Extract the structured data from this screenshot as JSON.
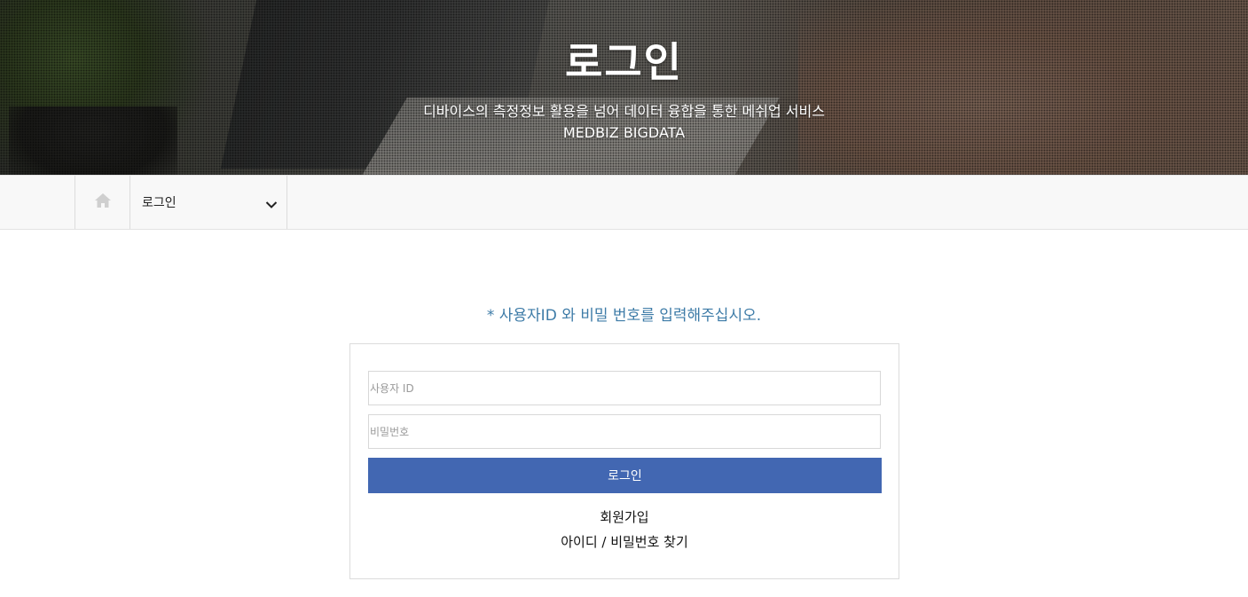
{
  "hero": {
    "title": "로그인",
    "subtitle": "디바이스의 측정정보 활용을 넘어 데이터 융합을 통한 메쉬업 서비스",
    "subtitle2": "MEDBIZ BIGDATA"
  },
  "breadcrumb": {
    "home_icon": "home-icon",
    "current": "로그인",
    "dropdown_icon": "chevron-down-icon"
  },
  "login": {
    "notice": "* 사용자ID 와 비밀 번호를 입력해주십시오.",
    "id_placeholder": "사용자 ID",
    "id_value": "",
    "pw_placeholder": "비밀번호",
    "pw_value": "",
    "submit_label": "로그인",
    "signup_link": "회원가입",
    "find_link": "아이디 / 비밀번호 찾기"
  },
  "colors": {
    "accent": "#4267b2",
    "notice": "#3d7ba7"
  }
}
